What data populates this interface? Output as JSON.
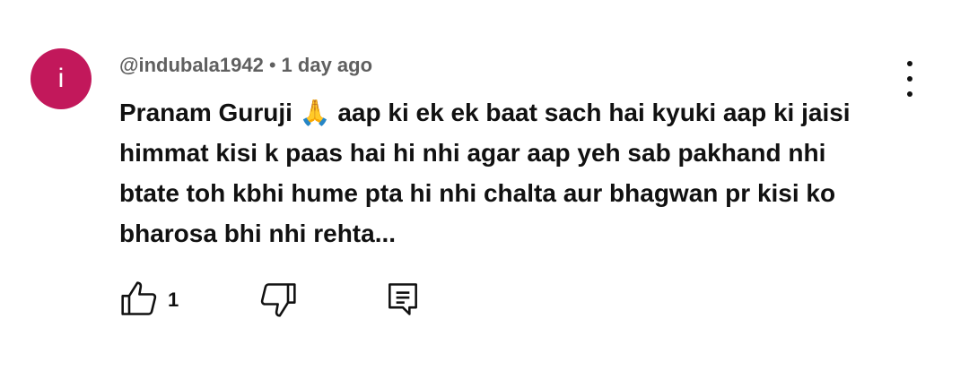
{
  "comment": {
    "avatar_letter": "i",
    "avatar_color": "#c2185b",
    "author": "@indubala1942",
    "separator": "•",
    "time": "1 day ago",
    "text": "Pranam Guruji 🙏 aap ki ek ek baat sach hai kyuki aap ki jaisi himmat kisi k paas hai hi nhi agar aap yeh sab pakhand nhi btate toh kbhi hume pta hi nhi chalta aur bhagwan pr kisi ko bharosa bhi nhi rehta...",
    "like_count": "1"
  },
  "icons": {
    "menu": "more-vert-icon",
    "like": "thumb-up-icon",
    "dislike": "thumb-down-icon",
    "reply": "reply-comment-icon"
  }
}
